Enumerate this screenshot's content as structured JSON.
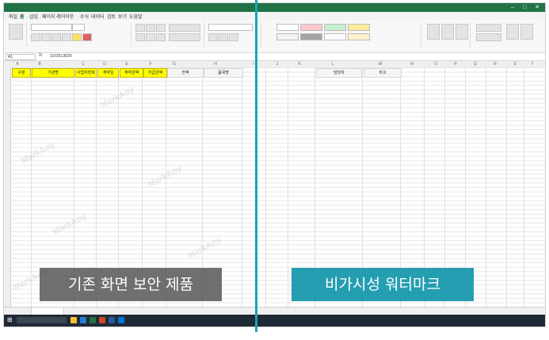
{
  "ribbon_tabs": [
    "파일",
    "홈",
    "삽입",
    "페이지 레이아웃",
    "수식",
    "데이터",
    "검토",
    "보기",
    "도움말"
  ],
  "formula": {
    "cell": "A1",
    "value": "1102513029"
  },
  "columns": [
    "A",
    "B",
    "C",
    "D",
    "E",
    "F",
    "G",
    "H",
    "I",
    "J",
    "K",
    "L",
    "M",
    "N",
    "O",
    "P",
    "Q",
    "R",
    "S",
    "T"
  ],
  "header_cells": [
    "구분",
    "기관명",
    "사업자번호",
    "계약일",
    "계약금액",
    "지급금액",
    "잔액",
    "품목명",
    "담당자",
    "비고"
  ],
  "watermark_text": "MarkAny",
  "labels": {
    "left": "기존 화면 보안 제품",
    "right": "비가시성 워터마크"
  },
  "colors": {
    "excel_green": "#217346",
    "header_yellow": "#ffff00",
    "accent_teal": "#1aa3b5",
    "left_label_bg": "#505050"
  }
}
